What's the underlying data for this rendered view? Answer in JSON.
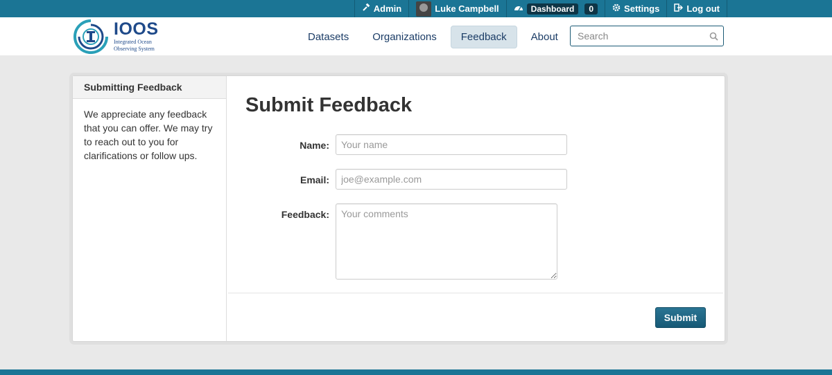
{
  "account": {
    "admin_label": "Admin",
    "user_name": "Luke Campbell",
    "dashboard_label": "Dashboard",
    "dashboard_count": "0",
    "settings_label": "Settings",
    "logout_label": "Log out"
  },
  "logo": {
    "title": "IOOS",
    "subtitle_line1": "Integrated Ocean",
    "subtitle_line2": "Observing System"
  },
  "nav": {
    "items": [
      {
        "label": "Datasets",
        "active": false
      },
      {
        "label": "Organizations",
        "active": false
      },
      {
        "label": "Feedback",
        "active": true
      },
      {
        "label": "About",
        "active": false
      }
    ]
  },
  "search": {
    "placeholder": "Search",
    "value": ""
  },
  "sidebar": {
    "heading": "Submitting Feedback",
    "body": "We appreciate any feedback that you can offer. We may try to reach out to you for clarifications or follow ups."
  },
  "form": {
    "title": "Submit Feedback",
    "name_label": "Name:",
    "name_placeholder": "Your name",
    "email_label": "Email:",
    "email_placeholder": "joe@example.com",
    "feedback_label": "Feedback:",
    "feedback_placeholder": "Your comments",
    "submit_label": "Submit"
  },
  "colors": {
    "brand_bar": "#1b7595",
    "logo_blue": "#1f4a8a",
    "nav_active_bg": "#d7e3ea",
    "button": "#1f6785"
  }
}
